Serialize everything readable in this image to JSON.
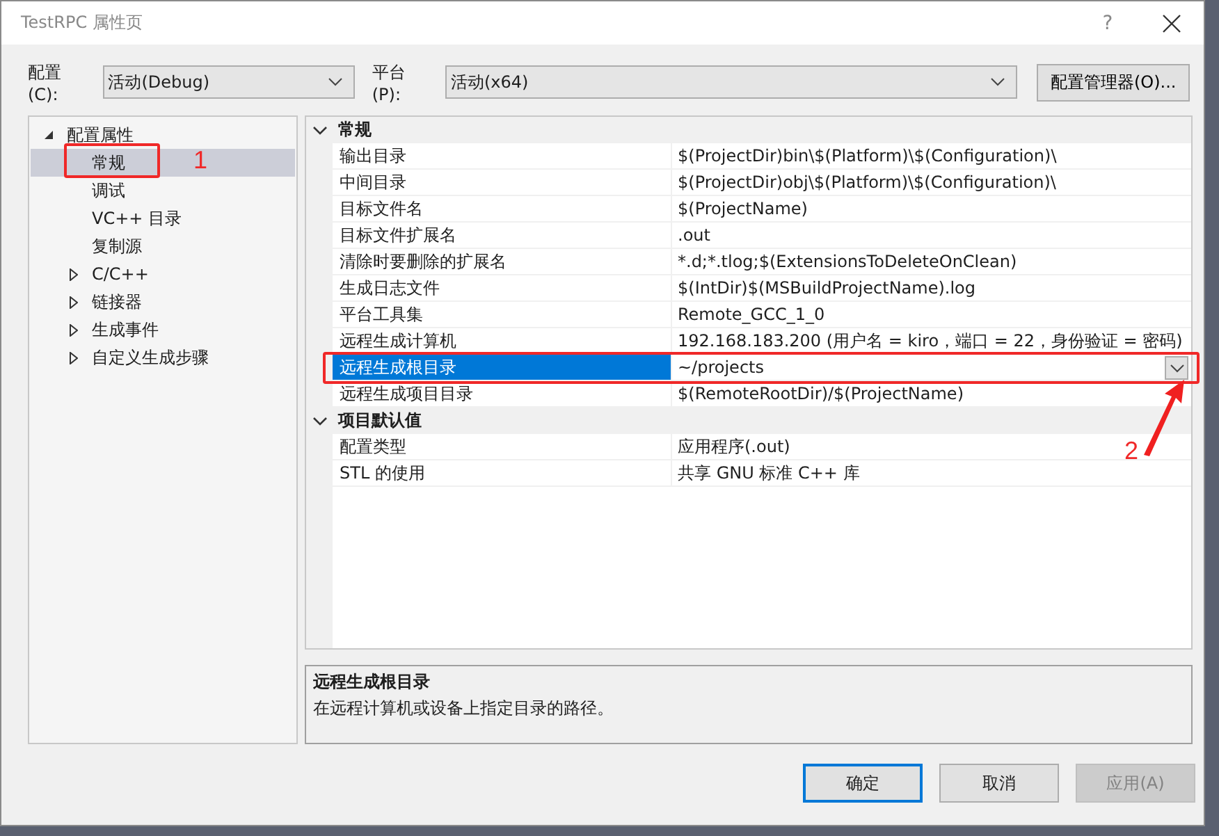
{
  "window": {
    "title": "TestRPC 属性页",
    "help": "?"
  },
  "toolbar": {
    "config_label": "配置(C):",
    "config_value": "活动(Debug)",
    "platform_label": "平台(P):",
    "platform_value": "活动(x64)",
    "manager_button": "配置管理器(O)..."
  },
  "tree": [
    {
      "label": "配置属性",
      "expanded": true,
      "selected": false,
      "children": [
        {
          "label": "常规",
          "selected": true,
          "highlighted": true
        },
        {
          "label": "调试",
          "selected": false,
          "highlighted": false
        },
        {
          "label": "VC++ 目录",
          "selected": false,
          "highlighted": false
        },
        {
          "label": "复制源",
          "selected": false,
          "highlighted": false
        },
        {
          "label": "C/C++",
          "selected": false,
          "highlighted": false,
          "expanded": false
        },
        {
          "label": "链接器",
          "selected": false,
          "highlighted": false,
          "expanded": false
        },
        {
          "label": "生成事件",
          "selected": false,
          "highlighted": false,
          "expanded": false
        },
        {
          "label": "自定义生成步骤",
          "selected": false,
          "highlighted": false,
          "expanded": false
        }
      ]
    }
  ],
  "properties": [
    {
      "category": "常规",
      "expanded": true,
      "rows": [
        {
          "name": "输出目录",
          "value": "$(ProjectDir)bin\\$(Platform)\\$(Configuration)\\",
          "selected": false,
          "highlighted": false
        },
        {
          "name": "中间目录",
          "value": "$(ProjectDir)obj\\$(Platform)\\$(Configuration)\\",
          "selected": false,
          "highlighted": false
        },
        {
          "name": "目标文件名",
          "value": "$(ProjectName)",
          "selected": false,
          "highlighted": false
        },
        {
          "name": "目标文件扩展名",
          "value": ".out",
          "selected": false,
          "highlighted": false
        },
        {
          "name": "清除时要删除的扩展名",
          "value": "*.d;*.tlog;$(ExtensionsToDeleteOnClean)",
          "selected": false,
          "highlighted": false
        },
        {
          "name": "生成日志文件",
          "value": "$(IntDir)$(MSBuildProjectName).log",
          "selected": false,
          "highlighted": false
        },
        {
          "name": "平台工具集",
          "value": "Remote_GCC_1_0",
          "selected": false,
          "highlighted": false
        },
        {
          "name": "远程生成计算机",
          "value": "192.168.183.200 (用户名 = kiro，端口 = 22，身份验证 = 密码)",
          "selected": false,
          "highlighted": false
        },
        {
          "name": "远程生成根目录",
          "value": "~/projects",
          "selected": true,
          "highlighted": true
        },
        {
          "name": "远程生成项目目录",
          "value": "$(RemoteRootDir)/$(ProjectName)",
          "selected": false,
          "highlighted": false
        }
      ]
    },
    {
      "category": "项目默认值",
      "expanded": true,
      "rows": [
        {
          "name": "配置类型",
          "value": "应用程序(.out)",
          "selected": false,
          "highlighted": false
        },
        {
          "name": "STL 的使用",
          "value": "共享 GNU 标准 C++ 库",
          "selected": false,
          "highlighted": false
        }
      ]
    }
  ],
  "description": {
    "title": "远程生成根目录",
    "text": "在远程计算机或设备上指定目录的路径。"
  },
  "buttons": [
    {
      "label": "确定",
      "default": true,
      "disabled": false
    },
    {
      "label": "取消",
      "default": false,
      "disabled": false
    },
    {
      "label": "应用(A)",
      "default": false,
      "disabled": true
    }
  ],
  "markers": [
    {
      "kind": "label",
      "text": "1"
    },
    {
      "kind": "arrow",
      "text": "2"
    }
  ]
}
